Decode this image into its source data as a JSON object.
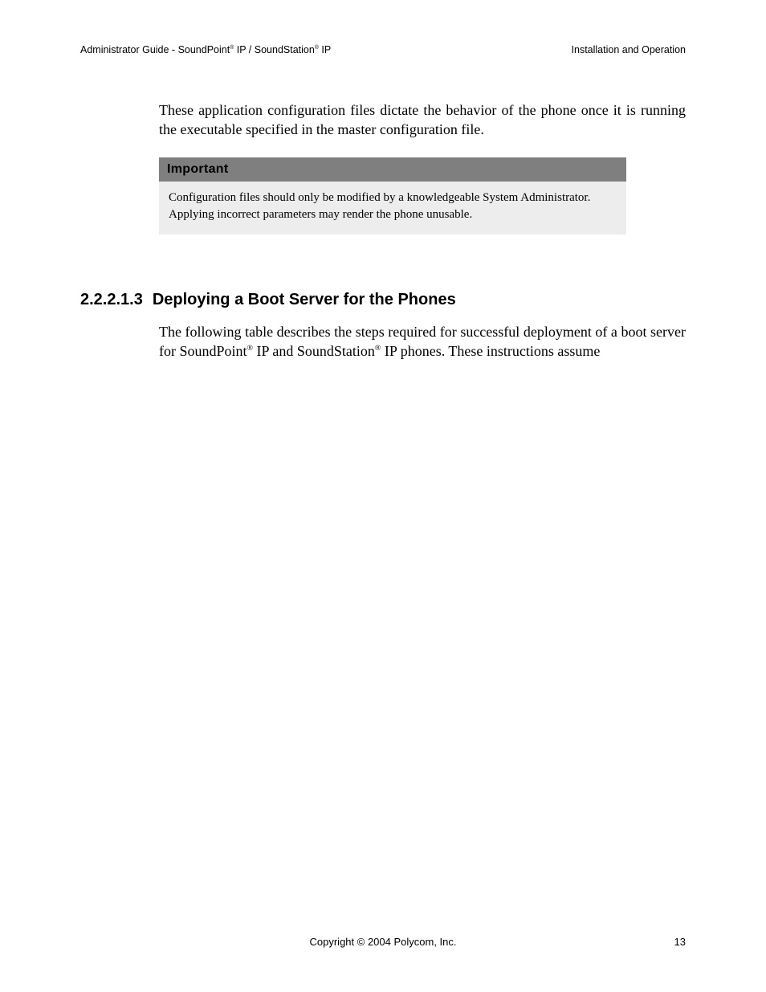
{
  "header": {
    "left_prefix": "Administrator Guide - SoundPoint",
    "left_mid": " IP / SoundStation",
    "left_suffix": " IP",
    "right": "Installation and Operation"
  },
  "body": {
    "p1": "These application configuration files dictate the behavior of the phone once it is running the executable specified in the master configuration file."
  },
  "callout": {
    "title": "Important",
    "text": "Configuration files should only be modified by a knowledgeable System Administrator. Applying incorrect parameters may render the phone unusable."
  },
  "section": {
    "number": "2.2.2.1.3",
    "title": "Deploying a Boot Server for the Phones",
    "p_prefix": "The following table describes the steps required for successful deployment of a boot server for SoundPoint",
    "p_mid": " IP and SoundStation",
    "p_suffix": " IP phones.  These instructions assume"
  },
  "footer": {
    "copyright": "Copyright © 2004 Polycom, Inc.",
    "page": "13"
  },
  "reg": "®"
}
